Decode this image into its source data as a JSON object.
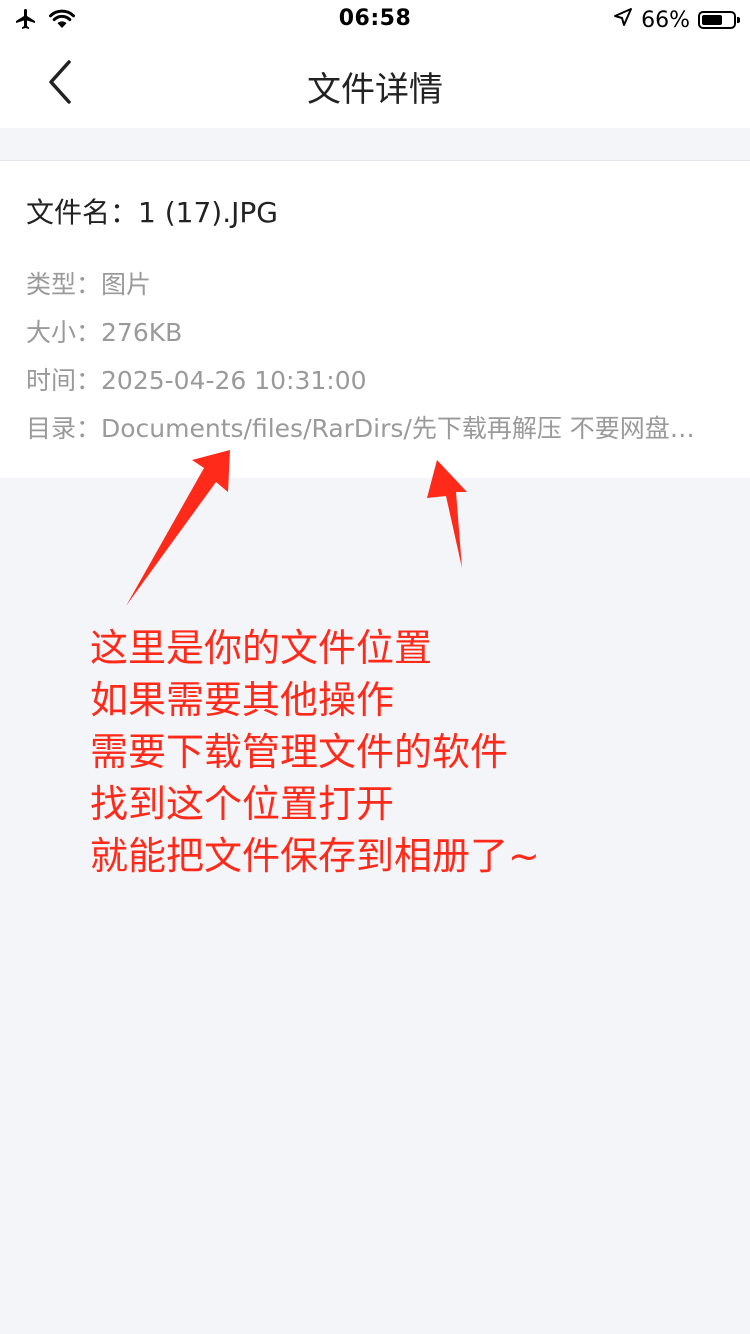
{
  "status_bar": {
    "time": "06:58",
    "battery_text": "66%",
    "battery_level": 0.66,
    "icons": [
      "airplane-icon",
      "wifi-icon",
      "location-icon",
      "battery-icon"
    ]
  },
  "nav": {
    "title": "文件详情",
    "back_icon": "chevron-left-icon"
  },
  "file": {
    "name_label": "文件名：",
    "name": "1 (17).JPG",
    "rows": [
      {
        "label": "类型：",
        "value": "图片"
      },
      {
        "label": "大小：",
        "value": "276KB"
      },
      {
        "label": "时间：",
        "value": "2025-04-26 10:31:00"
      },
      {
        "label": "目录：",
        "value": "Documents/files/RarDirs/先下载再解压 不要网盘…"
      }
    ]
  },
  "annotation": {
    "color": "#ff2a1a",
    "lines": [
      "这里是你的文件位置",
      "如果需要其他操作",
      "需要下载管理文件的软件",
      "找到这个位置打开",
      "就能把文件保存到相册了~"
    ]
  }
}
